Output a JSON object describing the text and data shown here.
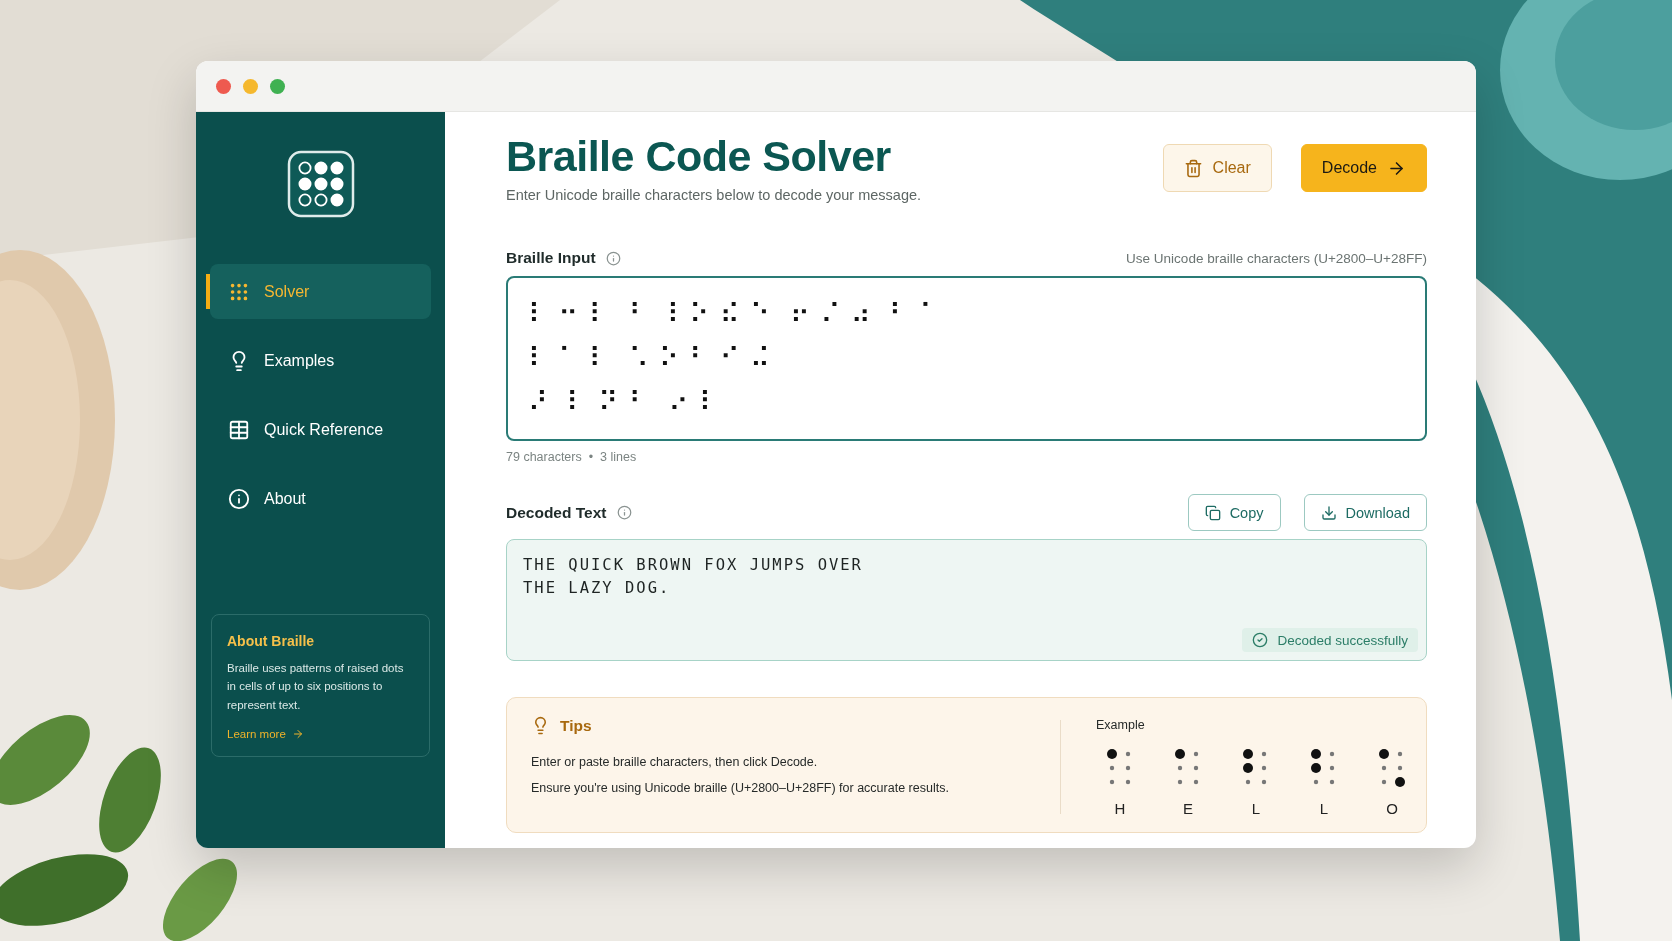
{
  "window": {
    "controls": [
      {
        "color": "#ee5a4f"
      },
      {
        "color": "#f5b82e"
      },
      {
        "color": "#3fb152"
      }
    ]
  },
  "sidebar": {
    "nav": [
      {
        "label": "Solver",
        "kind": "dots",
        "selected": true
      },
      {
        "label": "Examples",
        "kind": "bulb",
        "selected": false
      },
      {
        "label": "Quick Reference",
        "kind": "table",
        "selected": false
      },
      {
        "label": "About",
        "kind": "info",
        "selected": false
      }
    ],
    "info_card": {
      "title": "About Braille",
      "body": "Braille uses patterns of raised dots in cells of up to six positions to represent text.",
      "link": "Learn more"
    }
  },
  "header": {
    "title": "Braille Code Solver",
    "subtitle": "Enter Unicode braille characters below to decode your message.",
    "buttons": [
      {
        "label": "Clear",
        "kind": "secondary"
      },
      {
        "label": "Decode",
        "kind": "primary"
      }
    ]
  },
  "input": {
    "label": "Braille Input",
    "hint": "Use Unicode braille characters (U+2800–U+28FF)",
    "lines": [
      "⠇ ⠒ ⠇  ⠃ ⠸ ⠕ ⠮ ⠑  ⠖ ⠌ ⠴ ⠘ ⠈",
      "⠇ ⠁ ⠇  ⠡ ⠕ ⠃ ⠊ ⠬",
      "⠜ ⠸  ⠝ ⠃  ⠔ ⠇"
    ],
    "stats": "79 characters  •  3 lines"
  },
  "output": {
    "label": "Decoded Text",
    "buttons": [
      {
        "label": "Copy",
        "kind": "copy"
      },
      {
        "label": "Download",
        "kind": "download"
      }
    ],
    "lines": [
      "THE QUICK BROWN FOX JUMPS OVER",
      "THE LAZY DOG."
    ],
    "status": "Decoded successfully"
  },
  "tips": {
    "title": "Tips",
    "items": [
      "Enter or paste braille characters, then click Decode.",
      "Ensure you're using Unicode braille (U+2800–U+28FF) for accurate results."
    ],
    "example_label": "Example",
    "cells": [
      {
        "letter": "H",
        "dots": [
          true,
          false,
          false,
          false,
          false,
          false
        ]
      },
      {
        "letter": "E",
        "dots": [
          true,
          false,
          false,
          false,
          false,
          false
        ]
      },
      {
        "letter": "L",
        "dots": [
          true,
          true,
          false,
          false,
          false,
          false
        ]
      },
      {
        "letter": "L",
        "dots": [
          true,
          true,
          false,
          false,
          false,
          false
        ]
      },
      {
        "letter": "O",
        "dots": [
          true,
          false,
          false,
          false,
          false,
          true
        ]
      }
    ]
  }
}
